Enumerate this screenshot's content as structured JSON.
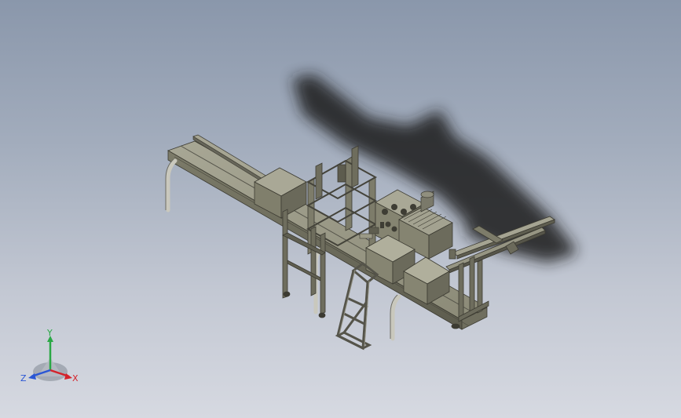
{
  "viewport": {
    "background_top": "#8a97ab",
    "background_bottom": "#d6d9e1"
  },
  "model": {
    "part_color": "#8e8d7a",
    "part_dark": "#5c5b4e",
    "part_light": "#b0af9c",
    "shadow_color": "#1e1e1e"
  },
  "triad": {
    "x_label": "X",
    "y_label": "Y",
    "z_label": "Z",
    "x_color": "#d4232b",
    "y_color": "#2aa845",
    "z_color": "#2a56d4"
  }
}
